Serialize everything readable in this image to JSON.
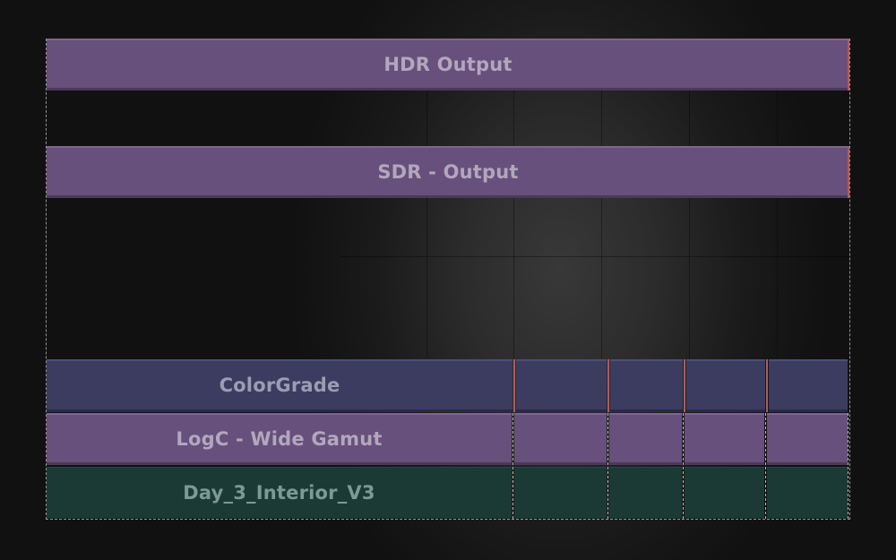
{
  "timeline": {
    "tracks": {
      "hdr_output": {
        "label": "HDR Output"
      },
      "sdr_output": {
        "label": "SDR - Output"
      },
      "color_grade": {
        "label": "ColorGrade"
      },
      "logc": {
        "label": "LogC - Wide Gamut"
      },
      "source": {
        "label": "Day_3_Interior_V3"
      }
    }
  },
  "colors": {
    "background": "#111111",
    "output_clip": "#67507b",
    "grade_clip": "#3b3c60",
    "source_clip": "#1c3a35",
    "edit_marker": "#b55a5a"
  }
}
